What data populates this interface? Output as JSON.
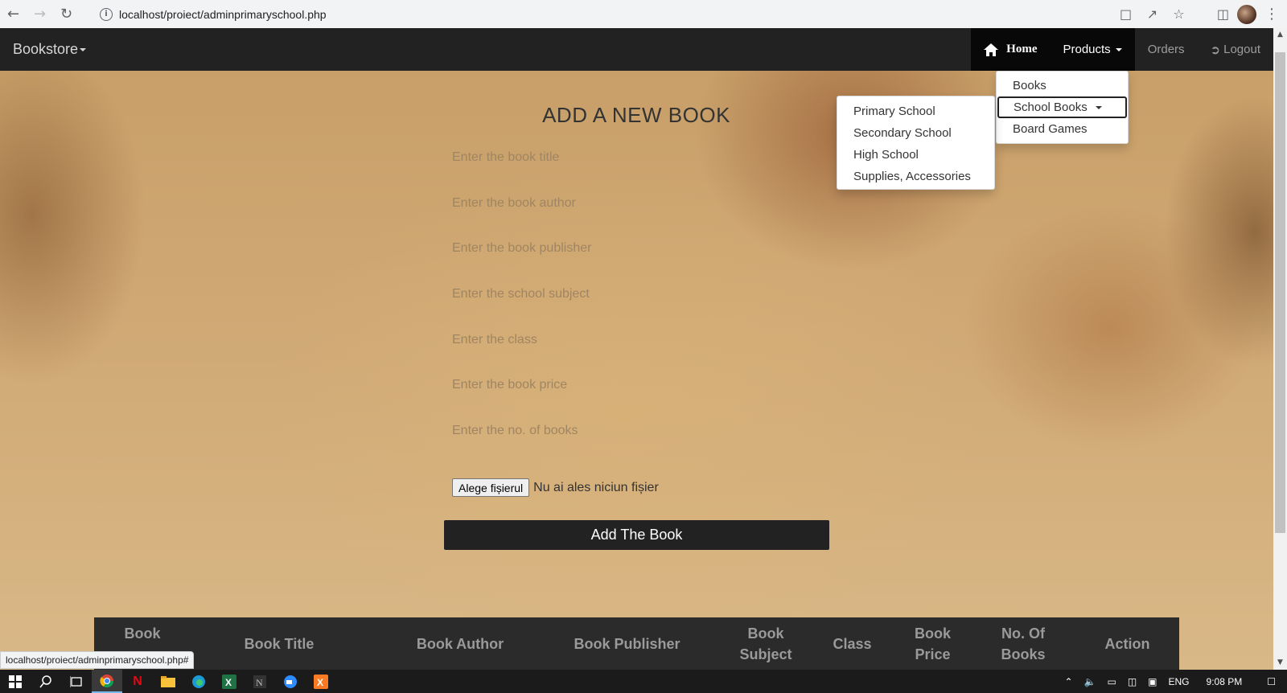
{
  "browser": {
    "url": "localhost/proiect/adminprimaryschool.php",
    "status_url": "localhost/proiect/adminprimaryschool.php#"
  },
  "navbar": {
    "brand": "Bookstore",
    "home": "Home",
    "products": "Products",
    "orders": "Orders",
    "logout": "Logout"
  },
  "products_menu": {
    "items": [
      "Books",
      "School Books",
      "Board Games"
    ]
  },
  "school_books_menu": {
    "items": [
      "Primary School",
      "Secondary School",
      "High School",
      "Supplies, Accessories"
    ]
  },
  "form": {
    "title": "ADD A NEW BOOK",
    "title_placeholder": "Enter the book title",
    "author_placeholder": "Enter the book author",
    "publisher_placeholder": "Enter the book publisher",
    "subject_placeholder": "Enter the school subject",
    "class_placeholder": "Enter the class",
    "price_placeholder": "Enter the book price",
    "count_placeholder": "Enter the no. of books",
    "file_button": "Alege fișierul",
    "file_status": "Nu ai ales niciun fișier",
    "submit": "Add The Book"
  },
  "table": {
    "headers": [
      "Book",
      "Book Title",
      "Book Author",
      "Book Publisher",
      "Book Subject",
      "Class",
      "Book Price",
      "No. Of Books",
      "Action"
    ]
  },
  "taskbar": {
    "lang": "ENG",
    "time": "9:08 PM"
  },
  "colors": {
    "navbar": "#222222",
    "accent": "#080808"
  }
}
